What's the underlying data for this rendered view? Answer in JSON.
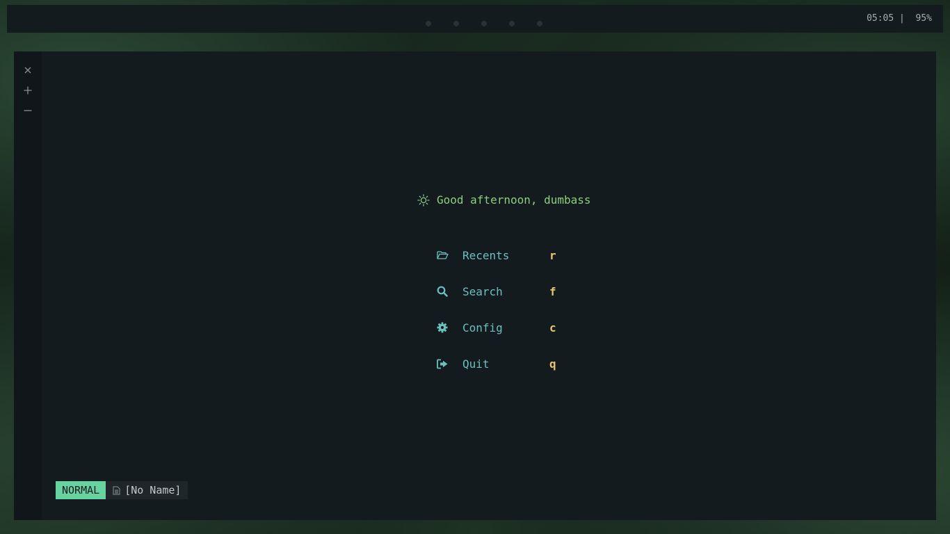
{
  "topbar": {
    "workspace_count": 5,
    "clock": "05:05",
    "separator": " | ",
    "battery": "95%"
  },
  "gutter": {
    "icons": [
      "close-icon",
      "plus-icon",
      "minus-icon"
    ]
  },
  "dashboard": {
    "greeting_icon": "sun-icon",
    "greeting": "Good afternoon, dumbass",
    "items": [
      {
        "icon": "folder-open-icon",
        "label": "Recents",
        "key": "r"
      },
      {
        "icon": "search-icon",
        "label": "Search",
        "key": "f"
      },
      {
        "icon": "gear-icon",
        "label": "Config",
        "key": "c"
      },
      {
        "icon": "sign-out-icon",
        "label": "Quit",
        "key": "q"
      }
    ]
  },
  "statusline": {
    "mode": "NORMAL",
    "file_icon": "file-icon",
    "filename": "[No Name]"
  },
  "colors": {
    "background": "#141b1e",
    "gutter": "#101619",
    "greeting": "#8ccf7e",
    "menu_label": "#6cbfbf",
    "menu_key": "#e5c76b",
    "mode_bg": "#67d3a0",
    "status_fg": "#c5c8c9"
  }
}
